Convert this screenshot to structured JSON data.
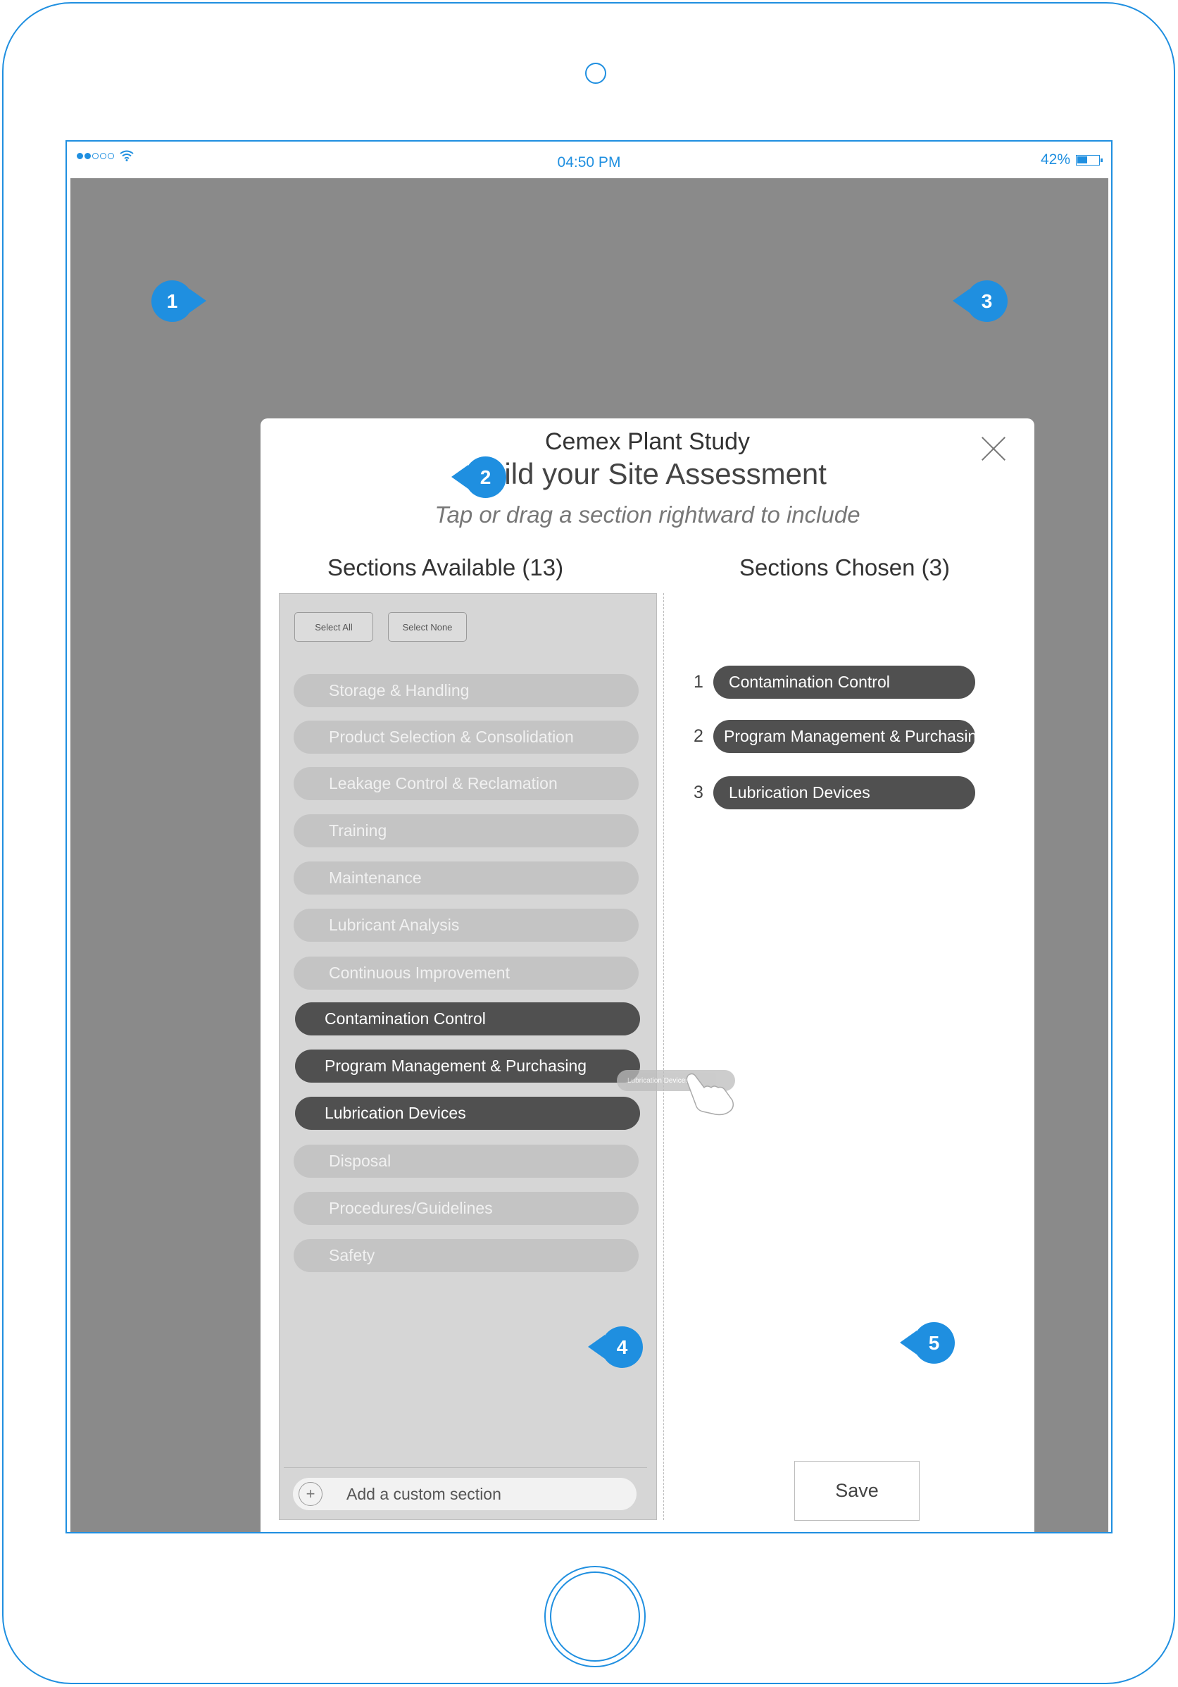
{
  "status_bar": {
    "time": "04:50 PM",
    "battery": "42%"
  },
  "modal": {
    "company": "Cemex Plant Study",
    "title": "Build your Site Assessment",
    "subtitle": "Tap or drag a section rightward to include",
    "available_header": "Sections Available (13)",
    "chosen_header": "Sections Chosen (3)",
    "select_all": "Select All",
    "select_none": "Select None",
    "available_sections": [
      {
        "label": "Storage & Handling",
        "selected": false
      },
      {
        "label": "Product Selection & Consolidation",
        "selected": false
      },
      {
        "label": "Leakage Control & Reclamation",
        "selected": false
      },
      {
        "label": "Training",
        "selected": false
      },
      {
        "label": "Maintenance",
        "selected": false
      },
      {
        "label": "Lubricant Analysis",
        "selected": false
      },
      {
        "label": "Continuous Improvement",
        "selected": false
      },
      {
        "label": "Contamination Control",
        "selected": true
      },
      {
        "label": "Program Management & Purchasing",
        "selected": true
      },
      {
        "label": "Lubrication Devices",
        "selected": true
      },
      {
        "label": "Disposal",
        "selected": false
      },
      {
        "label": "Procedures/Guidelines",
        "selected": false
      },
      {
        "label": "Safety",
        "selected": false
      }
    ],
    "chosen_sections": [
      {
        "num": "1",
        "label": "Contamination Control"
      },
      {
        "num": "2",
        "label": "Program Management & Purchasing"
      },
      {
        "num": "3",
        "label": "Lubrication Devices"
      }
    ],
    "drag_ghost": "Lubrication Devices",
    "add_custom": "Add a custom section",
    "add_icon": "+",
    "save": "Save"
  },
  "callouts": [
    "1",
    "2",
    "3",
    "4",
    "5"
  ],
  "colors": {
    "frame": "#1f8fe0",
    "overlay": "#8a8a8a",
    "selected_pill": "#505050",
    "unselected_pill": "#c4c4c4"
  }
}
